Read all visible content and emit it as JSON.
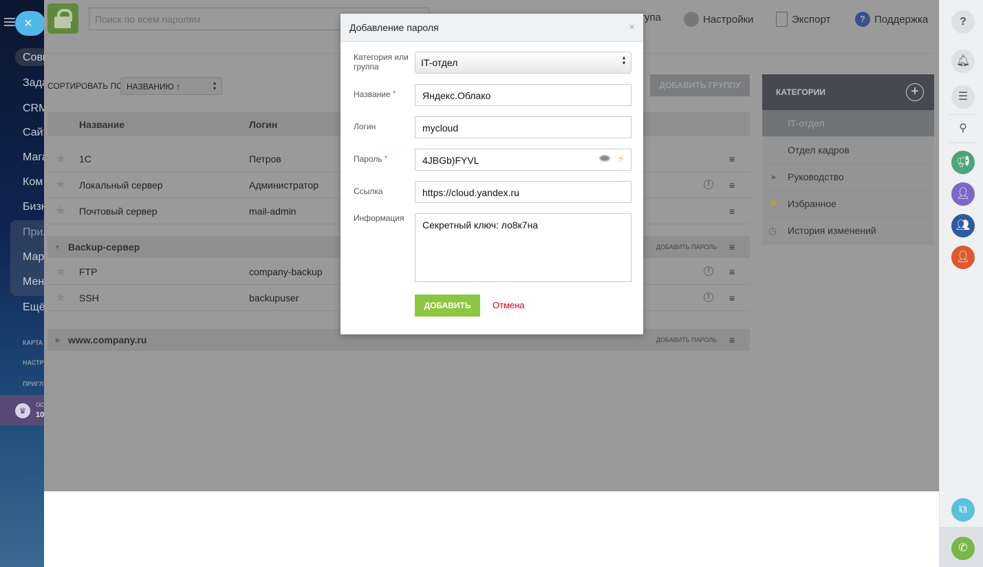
{
  "leftnav": {
    "items": [
      "Совм",
      "Зада",
      "CRM",
      "Сайт",
      "Мага",
      "Ком",
      "Бизн",
      "Прил",
      "Мар",
      "Мен",
      "Ещё"
    ],
    "small": [
      "КАРТА",
      "НАСТР",
      "ПРИГЛ"
    ],
    "promo": [
      "ОС",
      "10"
    ]
  },
  "header": {
    "search_placeholder": "Поиск по всем паролям",
    "menu": [
      "тупа",
      "Настройки",
      "Экспорт",
      "Поддержка"
    ]
  },
  "toolbar": {
    "sort_label": "СОРТИРОВАТЬ ПО",
    "sort_value": "НАЗВАНИЮ ↑",
    "add_group": "ДОБАВИТЬ ГРУППУ"
  },
  "table": {
    "columns": [
      "Название",
      "Логин"
    ],
    "rows": [
      {
        "name": "1С",
        "login": "Петров",
        "warn": false
      },
      {
        "name": "Локальный сервер",
        "login": "Администратор",
        "warn": true
      },
      {
        "name": "Почтовый сервер",
        "login": "mail-admin",
        "warn": false
      }
    ],
    "groups": [
      {
        "title": "Backup-сервер",
        "add": "ДОБАВИТЬ ПАРОЛЬ",
        "rows": [
          {
            "name": "FTP",
            "login": "company-backup",
            "warn": true
          },
          {
            "name": "SSH",
            "login": "backupuser",
            "warn": true
          }
        ]
      },
      {
        "title": "www.company.ru",
        "add": "ДОБАВИТЬ ПАРОЛЬ"
      }
    ]
  },
  "categories": {
    "title": "КАТЕГОРИИ",
    "items": [
      "IT-отдел",
      "Отдел кадров",
      "Руководство",
      "Избранное",
      "История изменений"
    ]
  },
  "modal": {
    "title": "Добавление пароля",
    "close": "×",
    "labels": {
      "category": "Категория или группа",
      "name": "Название",
      "login": "Логин",
      "password": "Пароль",
      "link": "Ссылка",
      "info": "Информация"
    },
    "required": "*",
    "values": {
      "category": "IT-отдел",
      "name": "Яндекс.Облако",
      "login": "mycloud",
      "password": "4JBGb)FYVL",
      "link": "https://cloud.yandex.ru",
      "info": "Секретный ключ: ло8к7на"
    },
    "add": "ДОБАВИТЬ",
    "cancel": "Отмена"
  },
  "colors": {
    "accent": "#8dc63f",
    "cancel": "#d0021b"
  }
}
